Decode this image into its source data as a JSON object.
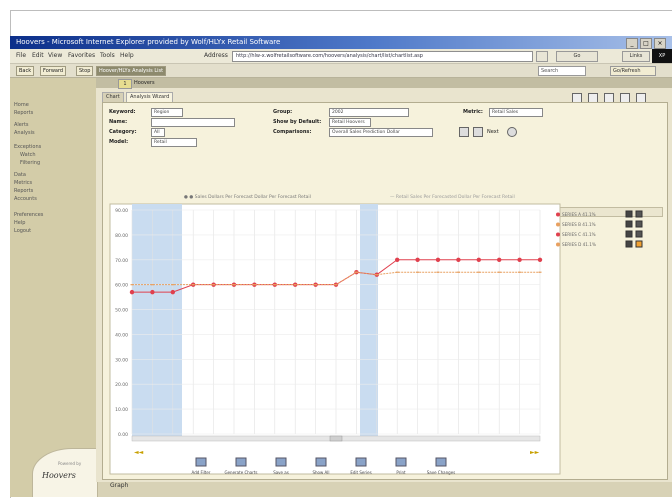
{
  "window": {
    "title": "Hoovers - Microsoft Internet Explorer provided by Wolf/HLYx Retail Software",
    "controls": [
      "_",
      "□",
      "×"
    ]
  },
  "menu": {
    "items": [
      "File",
      "Edit",
      "View",
      "Favorites",
      "Tools",
      "Help"
    ],
    "address_label": "Address",
    "address_value": "http://hlw-x.wolfretailsoftware.com/hoovers/analysis/chart/list/chartlist.asp",
    "go_label": "Go",
    "links_label": "Links",
    "brand": "XP"
  },
  "toolbar": {
    "back": "Back",
    "forward": "Forward",
    "stop": "Stop",
    "active": "Hoover/HLYx Analysis List",
    "search": "Search",
    "right_box": "Go/Refresh"
  },
  "sidebar": {
    "items": [
      "Home",
      "Reports",
      "Alerts",
      "Analysis",
      "Exceptions",
      "Watch",
      "Filtering",
      "Data",
      "Metrics",
      "Reports",
      "Accounts",
      "Preferences",
      "Help",
      "Logout"
    ],
    "brand": "Hoovers",
    "brand_sub": "Powered by",
    "bottom_tab": "Graph"
  },
  "content": {
    "index": "1",
    "label": "Hoovers",
    "tabs": [
      "Chart",
      "Analysis Wizard"
    ],
    "chips": [
      "Table",
      "Graph"
    ],
    "info_text": "Metric: Retail Sales  Comparisons: Overall Sales Prediction Dollar"
  },
  "form": {
    "keyword_label": "Keyword:",
    "keyword_value": "Region",
    "name_label": "Name:",
    "name_value": "",
    "category_label": "Category:",
    "category_value": "All",
    "model_label": "Model:",
    "model_value": "Retail",
    "group_label": "Group:",
    "group_value": "2002",
    "show_by_label": "Show by Default:",
    "show_by_value": "Retail Hoovers",
    "comparisons_label": "Comparisons:",
    "comparisons_value": "Overall Sales Prediction Dollar",
    "metric_label": "Metric:",
    "metric_value": "Retail Sales",
    "next_label": "Next"
  },
  "chart_data": {
    "type": "line",
    "y_ticks": [
      "90.00",
      "80.00",
      "70.00",
      "60.00",
      "50.00",
      "40.00",
      "30.00",
      "20.00",
      "10.00",
      "0.00"
    ],
    "ylim": [
      0,
      90
    ],
    "series": [
      {
        "name": "Sales Dollars Per Forecast Dollar Per Forecast Retail",
        "color": "#e0404e",
        "values": [
          57,
          57,
          57,
          60,
          60,
          60,
          60,
          60,
          60,
          60,
          60,
          65,
          64,
          70,
          70,
          70,
          70,
          70,
          70,
          70,
          70
        ]
      },
      {
        "name": "Retail Sales Per Forecasted Dollar Per Forecast Retail",
        "color": "#e8a060",
        "values": [
          60,
          60,
          60,
          60,
          60,
          60,
          60,
          60,
          60,
          60,
          60,
          65,
          64,
          65,
          65,
          65,
          65,
          65,
          65,
          65,
          65
        ]
      }
    ],
    "legend": [
      "SERIES A 41.1%",
      "SERIES B 41.1%",
      "SERIES C 41.1%",
      "SERIES D 41.1%"
    ],
    "bottom_buttons": [
      "Add Filter",
      "Generate Charts",
      "Save as",
      "Show All",
      "Edit Series",
      "Print",
      "Save Changes"
    ]
  }
}
